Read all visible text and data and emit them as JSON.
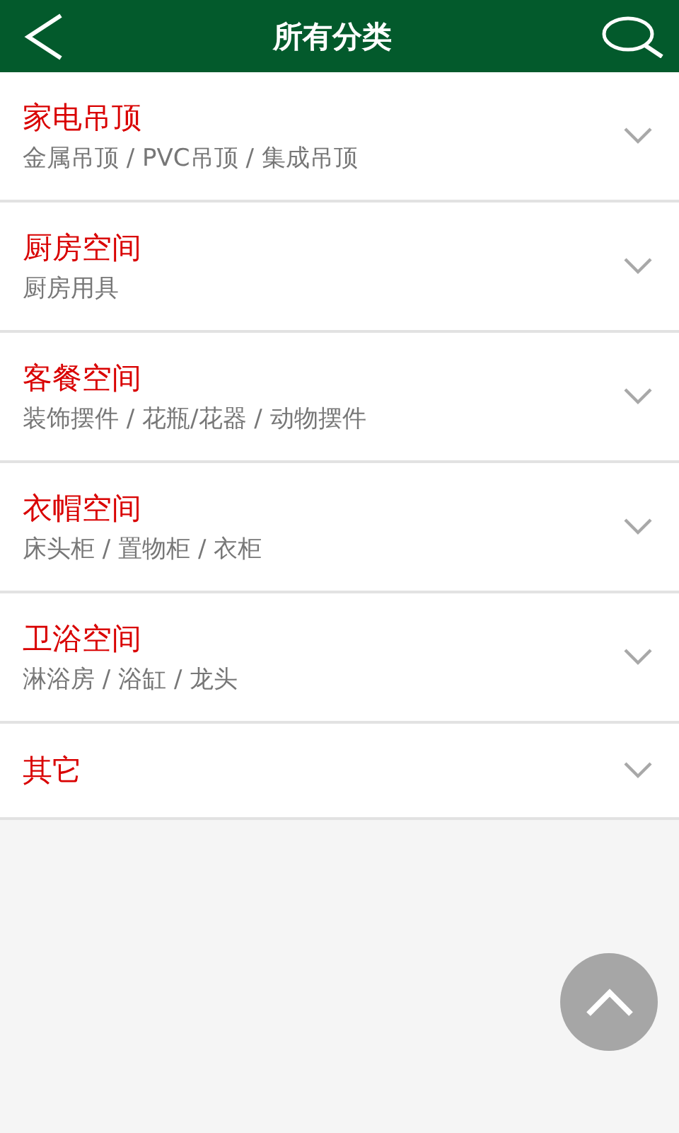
{
  "header": {
    "title": "所有分类"
  },
  "categories": [
    {
      "title": "家电吊顶",
      "subtitle": "金属吊顶 / PVC吊顶 / 集成吊顶",
      "expanded": false
    },
    {
      "title": "厨房空间",
      "subtitle": "厨房用具",
      "expanded": false
    },
    {
      "title": "客餐空间",
      "subtitle": "装饰摆件 / 花瓶/花器 / 动物摆件",
      "expanded": false
    },
    {
      "title": "衣帽空间",
      "subtitle": "床头柜 / 置物柜 / 衣柜",
      "expanded": false
    },
    {
      "title": "卫浴空间",
      "subtitle": "淋浴房 / 浴缸 / 龙头",
      "expanded": false
    },
    {
      "title": "其它",
      "expanded": false
    }
  ]
}
